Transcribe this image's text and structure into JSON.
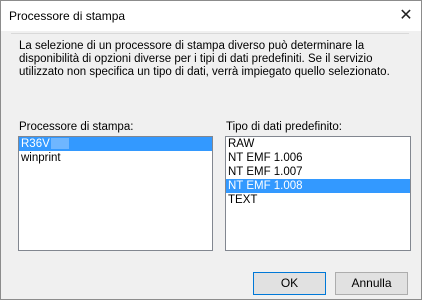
{
  "dialog": {
    "title": "Processore di stampa",
    "close_glyph": "✕",
    "description": "La selezione di un processore di stampa diverso può determinare la disponibilità di opzioni diverse per i tipi di dati predefiniti. Se il servizio utilizzato non specifica un tipo di dati, verrà impiegato quello selezionato."
  },
  "processors": {
    "label": "Processore di stampa:",
    "items": [
      {
        "label": "R36V",
        "selected": true
      },
      {
        "label": "winprint",
        "selected": false
      }
    ]
  },
  "datatypes": {
    "label": "Tipo di dati predefinito:",
    "items": [
      {
        "label": "RAW",
        "selected": false
      },
      {
        "label": "NT EMF 1.006",
        "selected": false
      },
      {
        "label": "NT EMF 1.007",
        "selected": false
      },
      {
        "label": "NT EMF 1.008",
        "selected": true
      },
      {
        "label": "TEXT",
        "selected": false
      }
    ]
  },
  "buttons": {
    "ok": "OK",
    "cancel": "Annulla"
  },
  "colors": {
    "selection": "#3399ff",
    "button_focus_border": "#0078d7"
  }
}
